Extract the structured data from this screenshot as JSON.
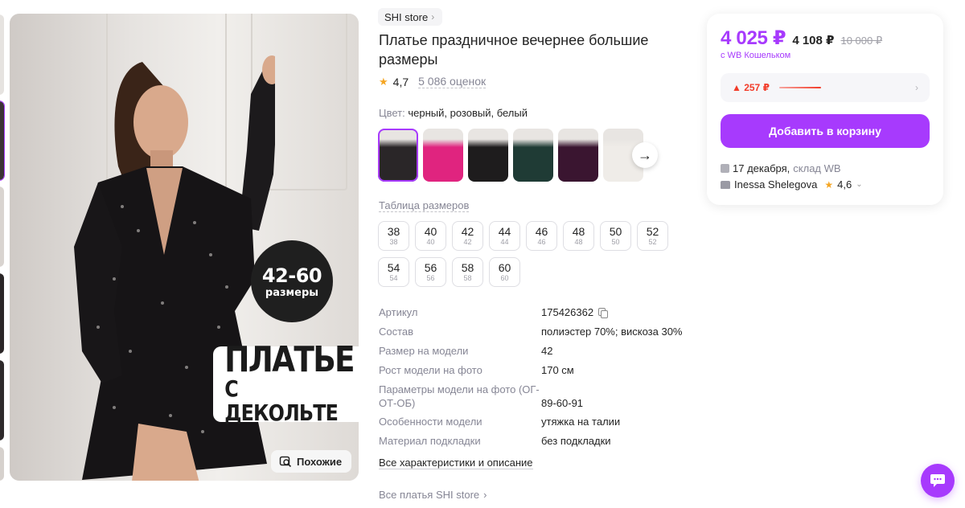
{
  "gallery": {
    "promo_circle_top": "42-60",
    "promo_circle_bottom": "размеры",
    "promo_box_line1": "ПЛАТЬЕ",
    "promo_box_line2": "С ДЕКОЛЬТЕ",
    "similar_button": "Похожие"
  },
  "product": {
    "store": "SHI store",
    "title": "Платье праздничное вечернее большие размеры",
    "rating": "4,7",
    "reviews": "5 086 оценок",
    "color_label": "Цвет:",
    "color_value": "черный, розовый, белый",
    "swatch_colors": [
      "#2a2628",
      "#e0247f",
      "#1e1c1d",
      "#1f3b35",
      "#3a1530",
      "#efece8"
    ],
    "size_table_link": "Таблица размеров",
    "sizes": [
      {
        "label": "38",
        "ru": "38"
      },
      {
        "label": "40",
        "ru": "40"
      },
      {
        "label": "42",
        "ru": "42"
      },
      {
        "label": "44",
        "ru": "44"
      },
      {
        "label": "46",
        "ru": "46"
      },
      {
        "label": "48",
        "ru": "48"
      },
      {
        "label": "50",
        "ru": "50"
      },
      {
        "label": "52",
        "ru": "52"
      },
      {
        "label": "54",
        "ru": "54"
      },
      {
        "label": "56",
        "ru": "56"
      },
      {
        "label": "58",
        "ru": "58"
      },
      {
        "label": "60",
        "ru": "60"
      }
    ],
    "specs": [
      {
        "key": "Артикул",
        "value": "175426362"
      },
      {
        "key": "Состав",
        "value": "полиэстер 70%; вискоза 30%"
      },
      {
        "key": "Размер на модели",
        "value": "42"
      },
      {
        "key": "Рост модели на фото",
        "value": "170 см"
      },
      {
        "key": "Параметры модели на фото (ОГ-ОТ-ОБ)",
        "value": "89-60-91"
      },
      {
        "key": "Особенности модели",
        "value": "утяжка на талии"
      },
      {
        "key": "Материал подкладки",
        "value": "без подкладки"
      }
    ],
    "all_specs_link": "Все характеристики и описание",
    "all_dresses_link": "Все платья SHI store"
  },
  "buy_card": {
    "price": "4 025 ₽",
    "price_old": "4 108 ₽",
    "price_original": "10 000 ₽",
    "wallet_note": "с WB Кошельком",
    "price_change": "▲ 257 ₽",
    "add_to_cart": "Добавить в корзину",
    "delivery_date": "17 декабря,",
    "delivery_warehouse": "склад WB",
    "seller_name": "Inessa Shelegova",
    "seller_rating": "4,6"
  },
  "colors": {
    "accent": "#a73afd",
    "price_up": "#f23c2a",
    "star": "#f5a623"
  }
}
